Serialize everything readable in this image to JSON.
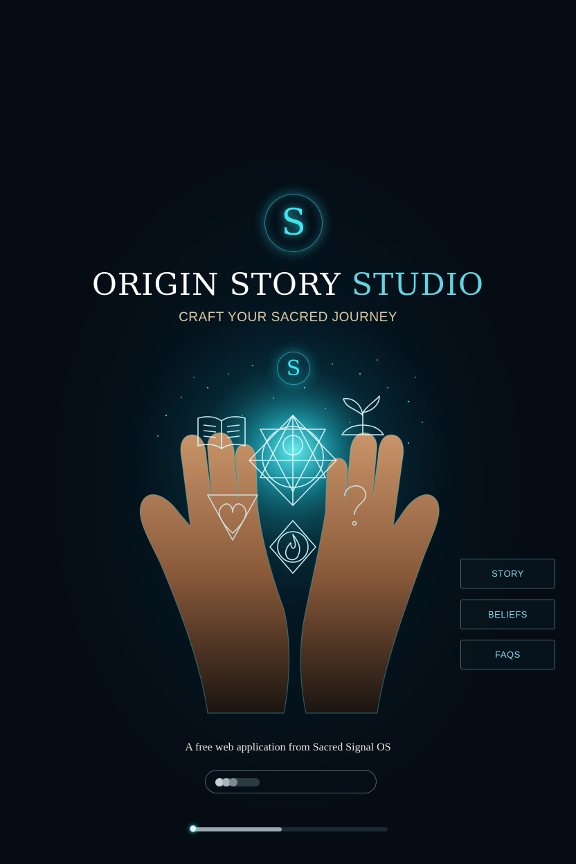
{
  "logo": {
    "letter": "S"
  },
  "title": {
    "main": "ORIGIN STORY",
    "accent": "STUDIO"
  },
  "tagline": "CRAFT YOUR SACRED JOURNEY",
  "nav": [
    {
      "label": "STORY"
    },
    {
      "label": "BELIEFS"
    },
    {
      "label": "FAQS"
    }
  ],
  "footer": {
    "text": "A free web application from Sacred Signal OS"
  },
  "progress": {
    "fraction": 0.46
  },
  "colors": {
    "accent": "#3fe3ee",
    "background": "#050c14",
    "tagline": "#dcc9a0"
  },
  "icons": [
    "book-icon",
    "sacred-geometry-icon",
    "sprout-icon",
    "heart-icon",
    "question-mark-icon",
    "flame-icon"
  ]
}
